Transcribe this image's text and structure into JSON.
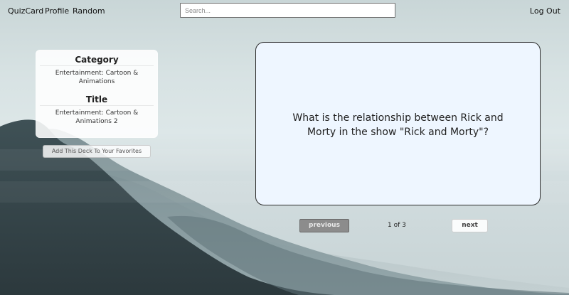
{
  "nav": {
    "brand": "QuizCard",
    "profile": "Profile",
    "random": "Random",
    "logout": "Log Out"
  },
  "search": {
    "placeholder": "Search..."
  },
  "deck": {
    "category_label": "Category",
    "category_value": "Entertainment: Cartoon & Animations",
    "title_label": "Title",
    "title_value": "Entertainment: Cartoon & Animations 2",
    "favorite_button": "Add This Deck To Your Favorites"
  },
  "card": {
    "question": "What is the relationship between Rick and Morty in the show \"Rick and Morty\"?"
  },
  "pager": {
    "previous": "previous",
    "indicator": "1 of 3",
    "next": "next"
  },
  "colors": {
    "accent": "#8c8c8c",
    "card_bg": "#eef6ff"
  }
}
